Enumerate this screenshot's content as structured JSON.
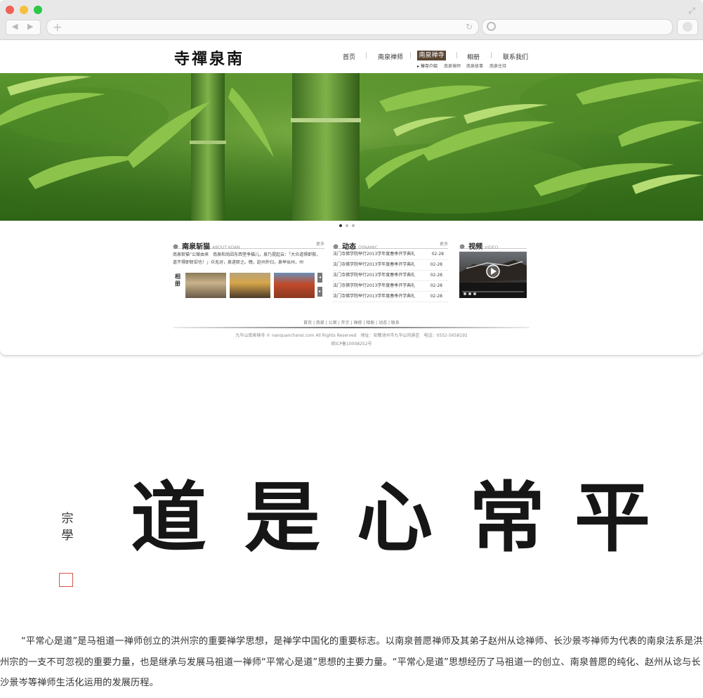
{
  "window": {
    "colors": {
      "red": "#f26057",
      "yellow": "#f6be3c",
      "green": "#2bc845"
    }
  },
  "site": {
    "logo": "寺禪泉南",
    "nav": [
      {
        "label": "首页"
      },
      {
        "label": "南泉禅师"
      },
      {
        "label": "南泉禅寺"
      },
      {
        "label": "相册"
      },
      {
        "label": "联系我们"
      }
    ],
    "active_nav": "南泉禅寺",
    "subnav": [
      "▸ 禅寺介绍",
      "南泉禅师",
      "南泉故事",
      "南泉住持"
    ],
    "about": {
      "title": "南泉斩猫",
      "en": "ABOUT KOAN",
      "more": "更多",
      "text": "南泉斩猫”公案由来　南泉和尚因东西堂争猫儿，泉乃提起云：「大众道得即救，道不得即斩却也！」众无对，泉遂斩之。晚，赵州外归，泉举似州，州",
      "album_label": "相册"
    },
    "dynamic": {
      "title": "动态",
      "en": "DYNAMIC",
      "more": "更多",
      "items": [
        {
          "title": "法门寺佛学院举行2013学年度春季开学典礼",
          "date": "02-28"
        },
        {
          "title": "法门寺佛学院举行2013学年度春季开学典礼",
          "date": "02-28"
        },
        {
          "title": "法门寺佛学院举行2013学年度春季开学典礼",
          "date": "02-28"
        },
        {
          "title": "法门寺佛学院举行2013学年度春季开学典礼",
          "date": "02-28"
        },
        {
          "title": "法门寺佛学院举行2013学年度春季开学典礼",
          "date": "02-28"
        }
      ]
    },
    "video": {
      "title": "视频",
      "en": "VIDEO"
    },
    "footer": {
      "links": "首页 | 南泉 | 公案 | 开示 | 禅修 | 相册 | 动态 | 联系",
      "copyright": "九华山南泉禅寺 © nanquanchansi.com All Rights Reserved　地址：安徽池州市九华山风景区　电话：0552-5658192",
      "icp": "皖ICP备10008252号"
    },
    "colors": {
      "accent": "#5a4634",
      "hero_green": "#3f7d20"
    }
  },
  "calligraphy": {
    "chars": [
      "道",
      "是",
      "心",
      "常",
      "平"
    ],
    "signature": "宗學"
  },
  "description": "“平常心是道”是马祖道一禅师创立的洪州宗的重要禅学思想，是禅学中国化的重要标志。以南泉普愿禅师及其弟子赵州从谂禅师、长沙景岑禅师为代表的南泉法系是洪州宗的一支不可忽视的重要力量，也是继承与发展马祖道一禅师“平常心是道”思想的主要力量。“平常心是道”思想经历了马祖道一的创立、南泉普愿的纯化、赵州从谂与长沙景岑等禅师生活化运用的发展历程。"
}
